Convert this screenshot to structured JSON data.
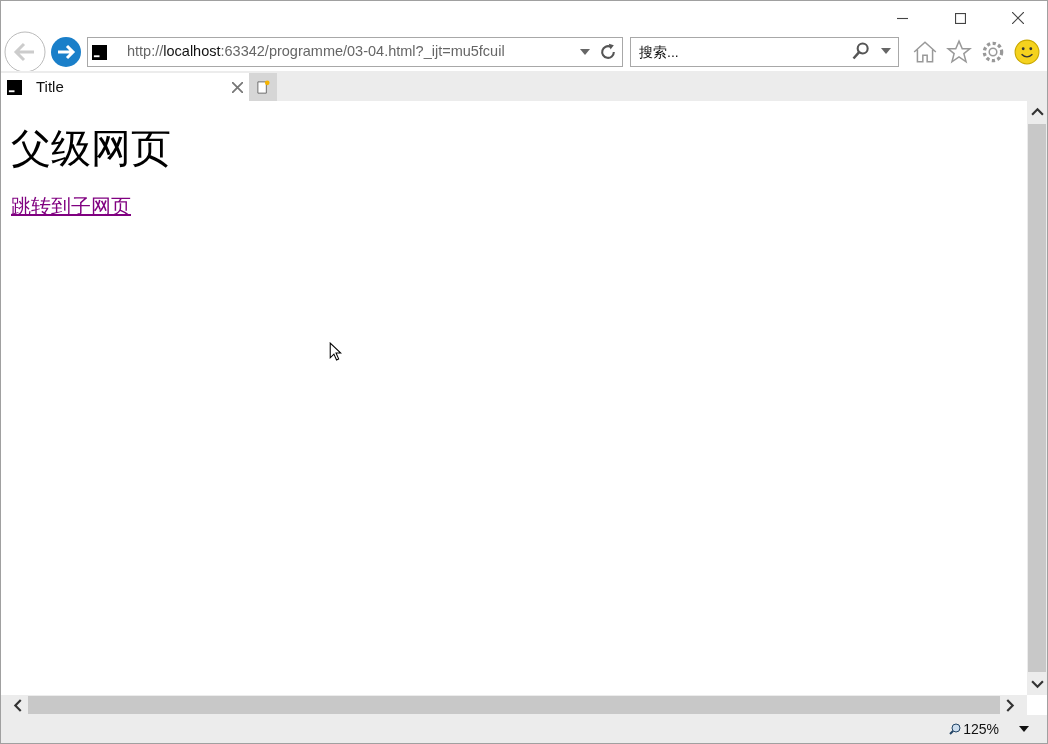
{
  "address": {
    "scheme": "http://",
    "host": "localhost",
    "rest": ":63342/programme/03-04.html?_ijt=mu5fcuil"
  },
  "search": {
    "placeholder": "搜索..."
  },
  "tabs": [
    {
      "label": "Title",
      "selected": true
    }
  ],
  "page": {
    "heading": "父级网页",
    "link": "跳转到子网页"
  },
  "status_bar": {
    "zoom": "125%"
  }
}
